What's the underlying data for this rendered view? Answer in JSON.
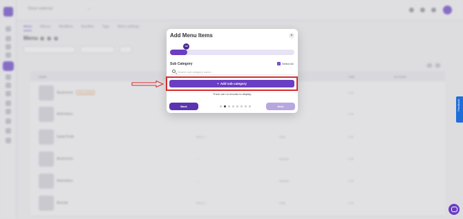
{
  "background": {
    "store_name": "Store selector",
    "tabs": [
      "Items",
      "Menus",
      "Modifiers",
      "Bundles",
      "Tags",
      "Menu settings"
    ],
    "page_title": "Menu",
    "table_headers": [
      "NAME",
      "CATEGORY",
      "PRICE",
      "TIME",
      "ACTIONS"
    ],
    "rows": [
      {
        "name": "Mushroom",
        "badge": "Out of stock",
        "cell1": "",
        "cell2": "",
        "cell3": "0.00"
      },
      {
        "name": "Artichokes",
        "badge": "",
        "cell1": "",
        "cell2": "",
        "cell3": "0.00"
      },
      {
        "name": "Salad Rolls",
        "badge": "",
        "cell1": "Menu 1",
        "cell2": "Daily",
        "cell3": "0.00"
      },
      {
        "name": "Mushroom",
        "badge": "",
        "cell1": "—",
        "cell2": "Regular",
        "cell3": "0.00"
      },
      {
        "name": "Artichokes",
        "badge": "",
        "cell1": "—",
        "cell2": "Regular",
        "cell3": "0.00"
      },
      {
        "name": "Burrata",
        "badge": "",
        "cell1": "Menu 2",
        "cell2": "Daily",
        "cell3": "0.00"
      }
    ]
  },
  "modal": {
    "title": "Add Menu Items",
    "progress_knob_label": "1/8",
    "progress_fraction": 0.14,
    "section_title": "Sub Category",
    "select_all_label": "Select All",
    "search_placeholder": "Search sub category name...",
    "add_button_label": "Add sub category",
    "empty_message": "There are no records to display.",
    "back_label": "Back",
    "next_label": "Next",
    "step_count": 8,
    "active_step": 1
  },
  "feedback_label": "Feedback",
  "colors": {
    "accent": "#6a3ec2",
    "highlight": "#d62a2a",
    "feedback": "#1e6fd9"
  }
}
